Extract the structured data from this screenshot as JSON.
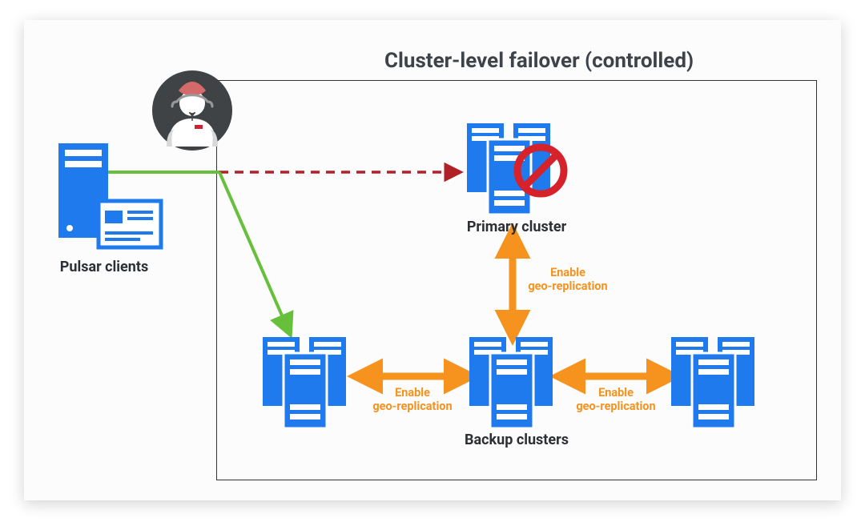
{
  "title": "Cluster-level failover (controlled)",
  "labels": {
    "pulsar_clients": "Pulsar clients",
    "primary_cluster": "Primary cluster",
    "backup_clusters": "Backup clusters",
    "geo_top": "Enable\ngeo-replication",
    "geo_left": "Enable\ngeo-replication",
    "geo_right": "Enable\ngeo-replication"
  },
  "colors": {
    "server_blue": "#1f7aed",
    "arrow_green": "#67c03b",
    "arrow_orange": "#f6921e",
    "arrow_red": "#b02026",
    "prohibit_red": "#d6222a",
    "text_dark": "#2c2f33"
  }
}
